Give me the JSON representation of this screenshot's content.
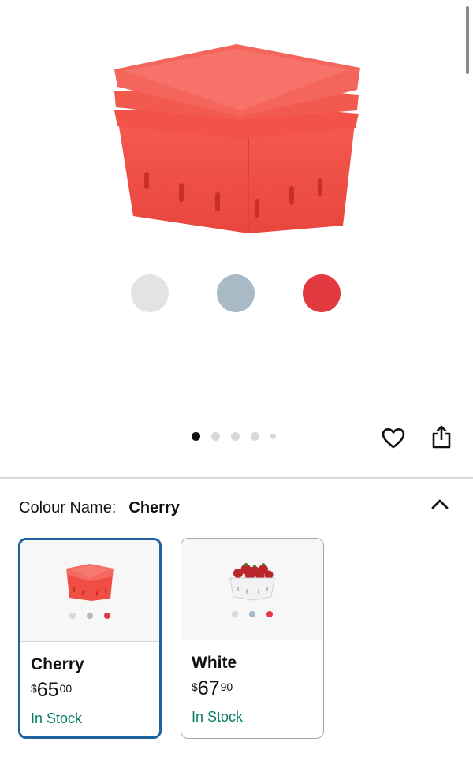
{
  "product": {
    "colour_swatches": [
      {
        "name": "white-swatch",
        "color": "#e3e3e3"
      },
      {
        "name": "blue-swatch",
        "color": "#a7bac6"
      },
      {
        "name": "red-swatch",
        "color": "#e2383f"
      }
    ],
    "accent_color": "#f04e45"
  },
  "carousel": {
    "total": 5,
    "active_index": 0
  },
  "actions": {
    "favourite_icon": "heart-icon",
    "share_icon": "share-icon"
  },
  "colour_selector": {
    "label": "Colour Name:",
    "selected": "Cherry",
    "collapse_icon": "chevron-up-icon"
  },
  "variants": [
    {
      "name": "Cherry",
      "currency": "$",
      "price_whole": "65",
      "price_fraction": "00",
      "availability": "In Stock",
      "selected": true,
      "dots": [
        "#d5d9d9",
        "#a7bac6",
        "#e2383f"
      ]
    },
    {
      "name": "White",
      "currency": "$",
      "price_whole": "67",
      "price_fraction": "90",
      "availability": "In Stock",
      "selected": false,
      "dots": [
        "#d5d9d9",
        "#a7bac6",
        "#e2383f"
      ]
    }
  ],
  "colors": {
    "selected_border": "#2162a1",
    "in_stock": "#067d62",
    "text": "#0f1111"
  }
}
